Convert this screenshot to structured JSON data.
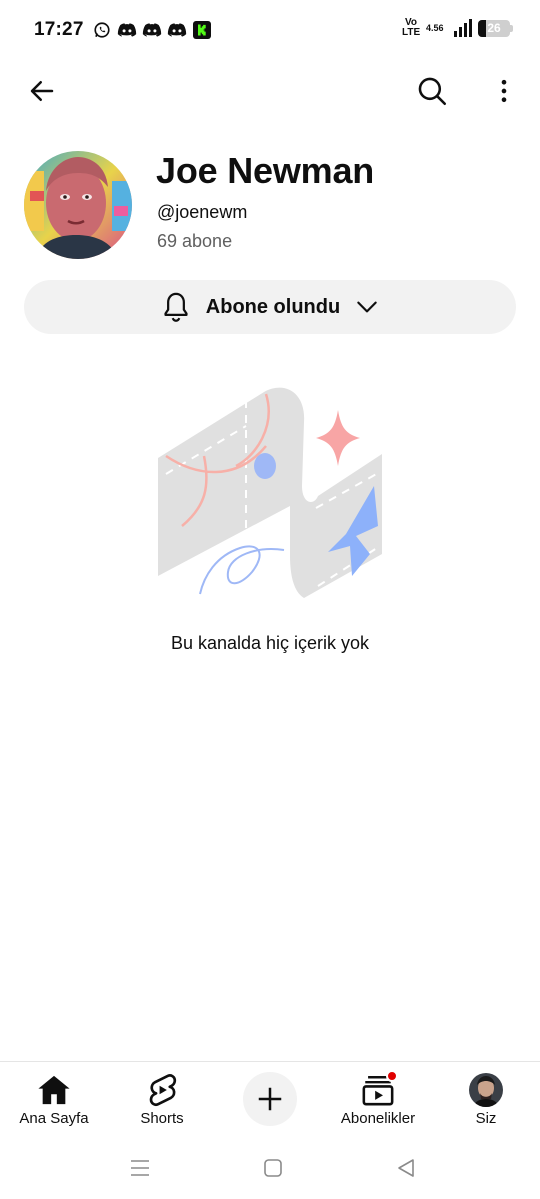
{
  "status_bar": {
    "time": "17:27",
    "network": "Vo LTE",
    "speed": "4.56",
    "battery": "26",
    "notification_icons": [
      "whatsapp-icon",
      "discord-icon",
      "discord-icon",
      "discord-icon",
      "kick-icon"
    ]
  },
  "app_bar": {
    "icons": [
      "arrow-back-icon",
      "search-icon",
      "more-vert-icon"
    ]
  },
  "channel": {
    "name": "Joe Newman",
    "handle": "@joenewm",
    "subscribers": "69 abone"
  },
  "subscribe_button": {
    "label": "Abone olundu",
    "icon": "bell-icon"
  },
  "empty_state": {
    "message": "Bu kanalda hiç içerik yok"
  },
  "bottom_nav": {
    "items": [
      {
        "label": "Ana Sayfa",
        "icon": "home-icon"
      },
      {
        "label": "Shorts",
        "icon": "shorts-icon"
      },
      {
        "label": "",
        "icon": "create-icon"
      },
      {
        "label": "Abonelikler",
        "icon": "subscriptions-icon"
      },
      {
        "label": "Siz",
        "icon": "avatar"
      }
    ]
  },
  "colors": {
    "accent": "#0f0f0f",
    "secondary_text": "#606060",
    "button_bg": "#f2f2f2",
    "badge": "#e00000"
  }
}
